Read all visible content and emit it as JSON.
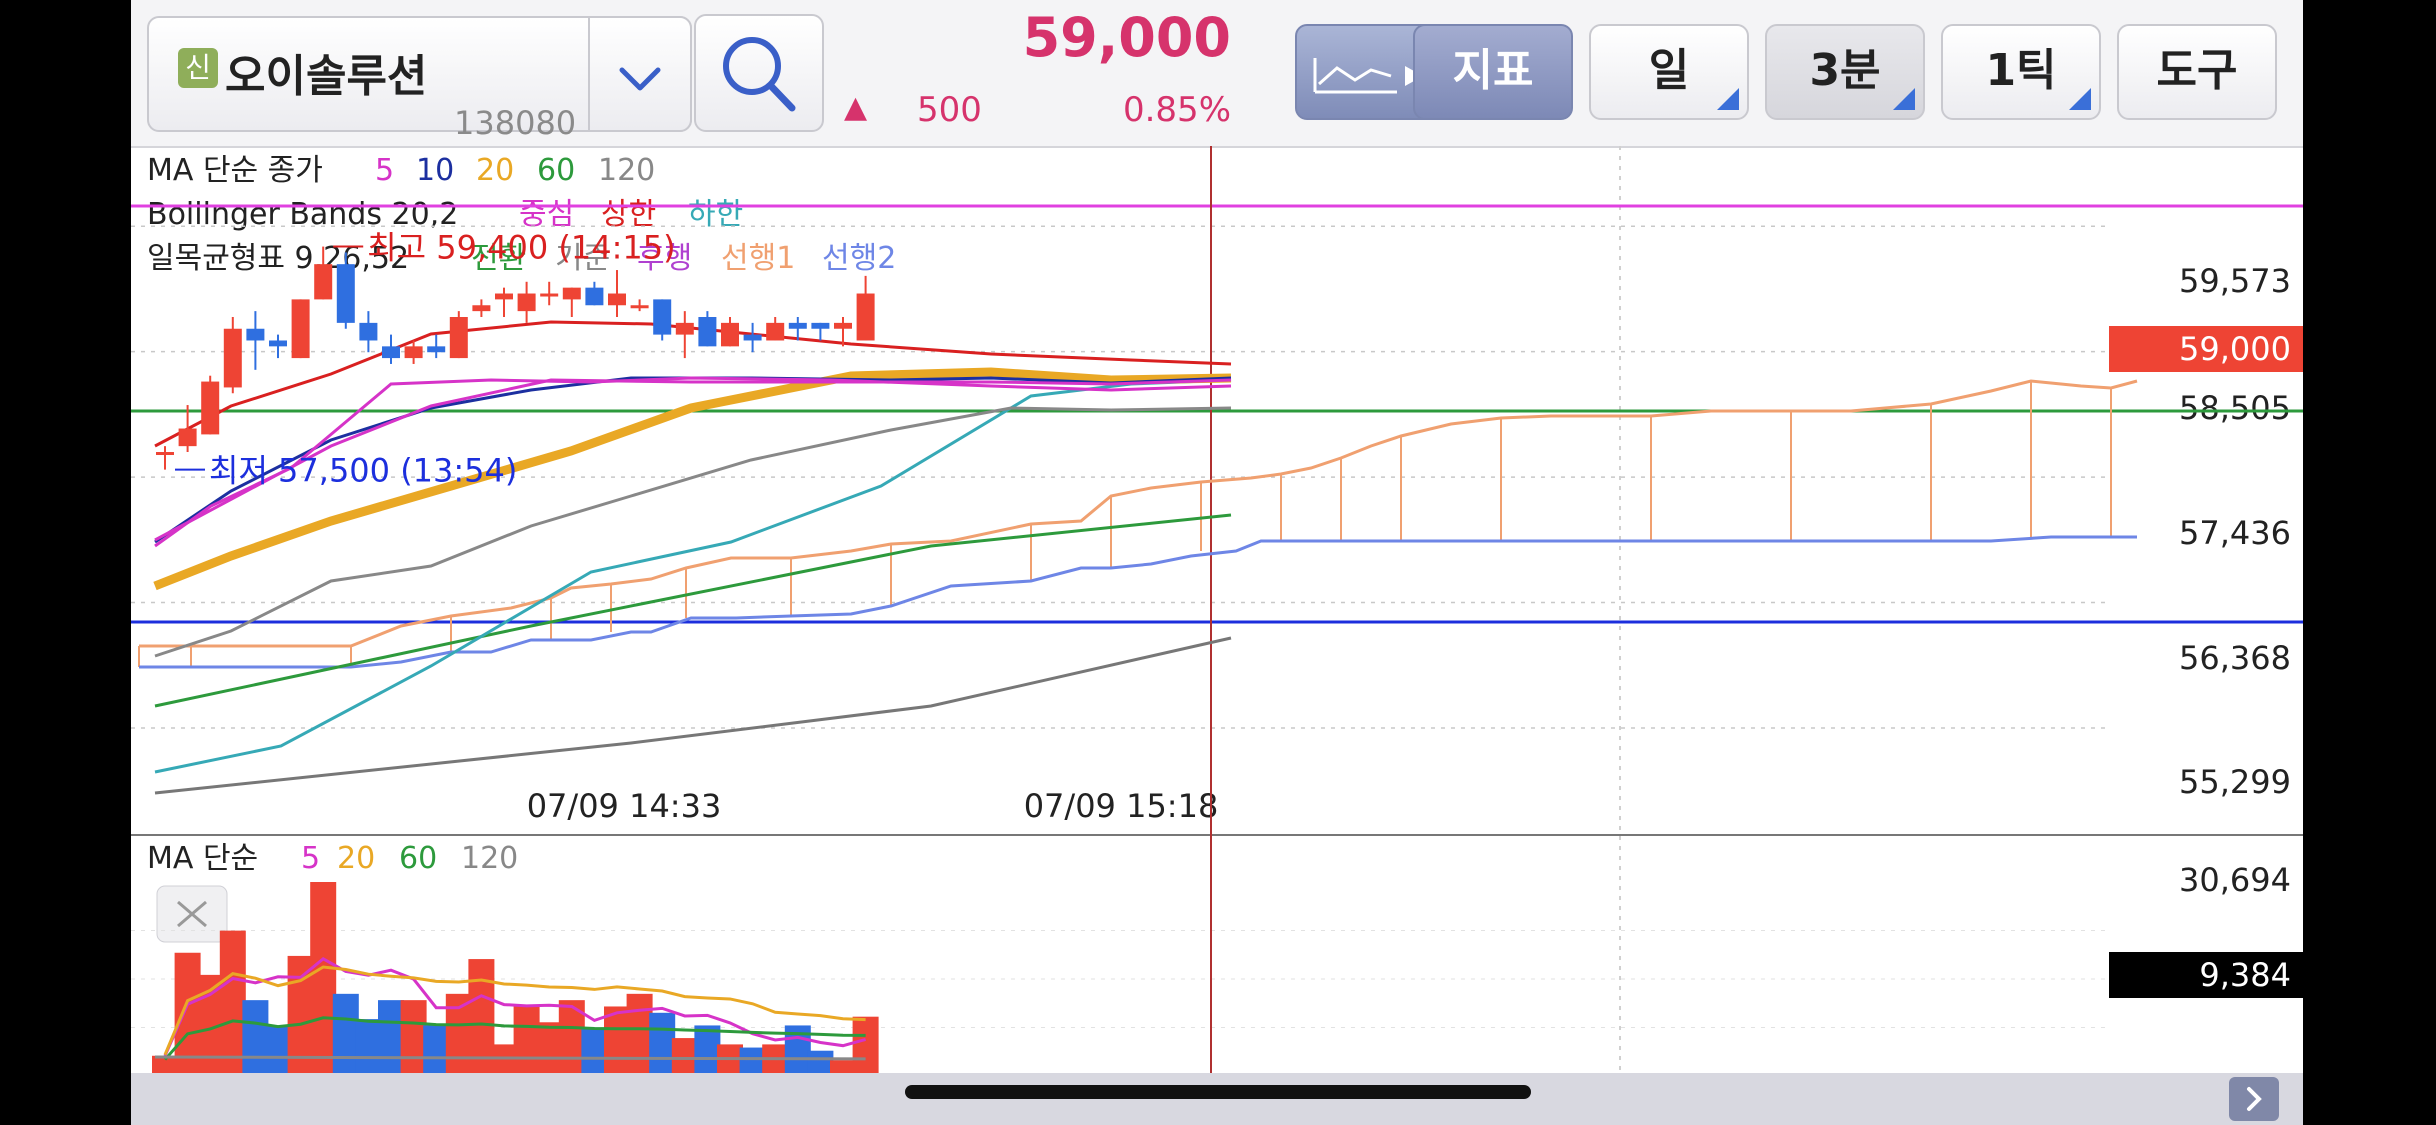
{
  "header": {
    "badge": "신",
    "stock_name": "오이솔루션",
    "stock_code": "138080",
    "price": "59,000",
    "change_arrow": "▲",
    "change": "500",
    "change_pct": "0.85%",
    "buttons": {
      "indicator": "지표",
      "period": "일",
      "interval": "3분",
      "tick": "1틱",
      "tools": "도구"
    }
  },
  "legend": {
    "ma_title": "MA 단순 종가",
    "ma_periods": [
      "5",
      "10",
      "20",
      "60",
      "120"
    ],
    "bb_title": "Bollinger Bands 20,2",
    "bb_items": [
      "중심",
      "상한",
      "하한"
    ],
    "ichimoku_title": "일목균형표 9,26,52",
    "ichimoku_items": [
      "전환",
      "기준",
      "후행",
      "선행1",
      "선행2"
    ]
  },
  "annotations": {
    "high": "최고 59,400 (14:15)",
    "low": "최저 57,500 (13:54)"
  },
  "price_axis": [
    "59,573",
    "58,505",
    "57,436",
    "56,368",
    "55,299"
  ],
  "current_price_label": "59,000",
  "time_labels": [
    "07/09 14:33",
    "07/09 15:18"
  ],
  "volume": {
    "title": "MA 단순",
    "periods": [
      "5",
      "20",
      "60",
      "120"
    ],
    "axis_max": "30,694",
    "current": "9,384"
  },
  "colors": {
    "up": "#ee4434",
    "down": "#2f6fe0",
    "ma5": "#d633c8",
    "ma10": "#1c2fa0",
    "ma20": "#e9a825",
    "ma60": "#2d9a3c",
    "ma120": "#888888",
    "bb_upper": "#d92020",
    "bb_lower": "#36a9b6",
    "span1": "#f0a070",
    "span2": "#6e86e6"
  },
  "chart_data": {
    "type": "candlestick",
    "interval": "3분",
    "ohlc": [
      {
        "o": 57650,
        "h": 57700,
        "l": 57500,
        "c": 57650
      },
      {
        "o": 57700,
        "h": 58050,
        "l": 57650,
        "c": 57850
      },
      {
        "o": 57800,
        "h": 58300,
        "l": 57800,
        "c": 58250
      },
      {
        "o": 58200,
        "h": 58800,
        "l": 58150,
        "c": 58700
      },
      {
        "o": 58700,
        "h": 58850,
        "l": 58350,
        "c": 58600
      },
      {
        "o": 58600,
        "h": 58650,
        "l": 58450,
        "c": 58550
      },
      {
        "o": 58450,
        "h": 58950,
        "l": 58450,
        "c": 58950
      },
      {
        "o": 58950,
        "h": 59400,
        "l": 58950,
        "c": 59250
      },
      {
        "o": 59250,
        "h": 59350,
        "l": 58700,
        "c": 58750
      },
      {
        "o": 58750,
        "h": 58850,
        "l": 58500,
        "c": 58600
      },
      {
        "o": 58550,
        "h": 58650,
        "l": 58400,
        "c": 58450
      },
      {
        "o": 58450,
        "h": 58600,
        "l": 58400,
        "c": 58550
      },
      {
        "o": 58550,
        "h": 58650,
        "l": 58450,
        "c": 58500
      },
      {
        "o": 58450,
        "h": 58850,
        "l": 58450,
        "c": 58800
      },
      {
        "o": 58850,
        "h": 58950,
        "l": 58800,
        "c": 58900
      },
      {
        "o": 58950,
        "h": 59050,
        "l": 58800,
        "c": 59000
      },
      {
        "o": 58850,
        "h": 59100,
        "l": 58750,
        "c": 59000
      },
      {
        "o": 59000,
        "h": 59100,
        "l": 58900,
        "c": 59000
      },
      {
        "o": 58950,
        "h": 59050,
        "l": 58800,
        "c": 59050
      },
      {
        "o": 59050,
        "h": 59100,
        "l": 58900,
        "c": 58900
      },
      {
        "o": 58900,
        "h": 59200,
        "l": 58800,
        "c": 59000
      },
      {
        "o": 58900,
        "h": 58950,
        "l": 58850,
        "c": 58900
      },
      {
        "o": 58950,
        "h": 58950,
        "l": 58600,
        "c": 58650
      },
      {
        "o": 58650,
        "h": 58850,
        "l": 58450,
        "c": 58750
      },
      {
        "o": 58800,
        "h": 58850,
        "l": 58550,
        "c": 58550
      },
      {
        "o": 58550,
        "h": 58800,
        "l": 58550,
        "c": 58750
      },
      {
        "o": 58650,
        "h": 58750,
        "l": 58500,
        "c": 58600
      },
      {
        "o": 58600,
        "h": 58800,
        "l": 58600,
        "c": 58750
      },
      {
        "o": 58750,
        "h": 58800,
        "l": 58600,
        "c": 58700
      },
      {
        "o": 58750,
        "h": 58750,
        "l": 58600,
        "c": 58700
      },
      {
        "o": 58700,
        "h": 58800,
        "l": 58550,
        "c": 58750
      },
      {
        "o": 58600,
        "h": 59150,
        "l": 58600,
        "c": 59000
      }
    ],
    "volume": [
      3200,
      19500,
      16000,
      23000,
      12000,
      8000,
      19000,
      30694,
      13000,
      9000,
      12000,
      12000,
      8000,
      13000,
      18500,
      5000,
      11000,
      8500,
      12000,
      7500,
      11000,
      13000,
      10000,
      6000,
      8000,
      5000,
      4500,
      5000,
      8000,
      4000,
      2500,
      9384
    ],
    "y_axis_ticks": [
      59573,
      58505,
      57436,
      56368,
      55299
    ],
    "time_labels": [
      "07/09 14:33",
      "07/09 15:18"
    ]
  }
}
